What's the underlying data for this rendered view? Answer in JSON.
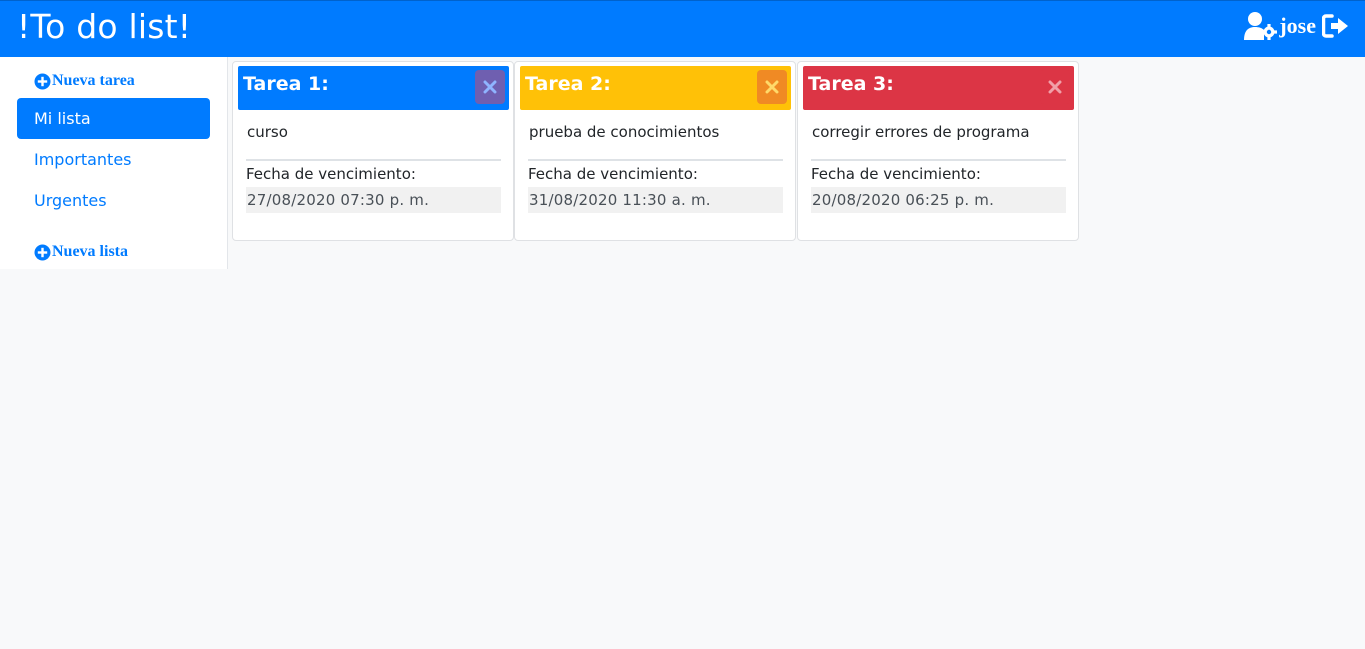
{
  "app": {
    "title": "!To do list!"
  },
  "user": {
    "name": "jose"
  },
  "sidebar": {
    "new_task_label": "Nueva tarea",
    "new_list_label": "Nueva lista",
    "items": [
      {
        "label": "Mi lista",
        "active": true
      },
      {
        "label": "Importantes",
        "active": false
      },
      {
        "label": "Urgentes",
        "active": false
      }
    ]
  },
  "cards": [
    {
      "title": "Tarea 1:",
      "description": "curso",
      "due_label": "Fecha de vencimiento:",
      "due_value": "27/08/2020 07:30 p. m.",
      "color": "#007bff",
      "close_bg": "#6f5fb0",
      "close_icon_color": "#8fb4ff"
    },
    {
      "title": "Tarea 2:",
      "description": "prueba de conocimientos",
      "due_label": "Fecha de vencimiento:",
      "due_value": "31/08/2020 11:30 a. m.",
      "color": "#ffc107",
      "close_bg": "#f08a24",
      "close_icon_color": "#ffd96a"
    },
    {
      "title": "Tarea 3:",
      "description": "corregir errores de programa",
      "due_label": "Fecha de vencimiento:",
      "due_value": "20/08/2020 06:25 p. m.",
      "color": "#dc3545",
      "close_bg": "#dc3545",
      "close_icon_color": "#f0a0a8"
    }
  ],
  "icons": {
    "user_settings": "user-cog-icon",
    "logout": "sign-out-icon",
    "add": "plus-circle-icon",
    "close": "close-icon"
  }
}
